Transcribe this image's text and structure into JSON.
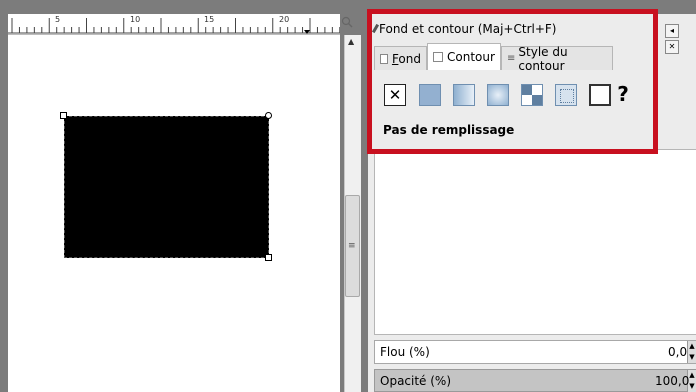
{
  "ruler": {
    "labels": [
      "5",
      "10",
      "15",
      "20"
    ]
  },
  "dock": {
    "title": "Fond et contour (Maj+Ctrl+F)",
    "tabs": [
      {
        "label": "Fond",
        "underline": "F",
        "rest": "ond"
      },
      {
        "label": "Contour"
      },
      {
        "label": "Style du contour"
      }
    ],
    "paint_types": [
      {
        "name": "no-paint",
        "glyph": "✕"
      },
      {
        "name": "flat-color"
      },
      {
        "name": "linear-gradient"
      },
      {
        "name": "radial-gradient"
      },
      {
        "name": "pattern"
      },
      {
        "name": "swatch"
      },
      {
        "name": "unset"
      },
      {
        "name": "unknown",
        "glyph": "?"
      }
    ],
    "paint_label": "Pas de remplissage",
    "blur": {
      "label": "Flou (%)",
      "value": "0,0"
    },
    "opacity": {
      "label": "Opacité (%)",
      "value": "100,0"
    }
  },
  "colors": {
    "highlight": "#c8101f",
    "shape_fill": "#000000"
  }
}
